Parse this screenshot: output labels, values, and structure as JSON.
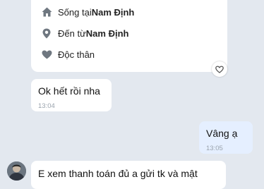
{
  "profile_card": {
    "rows": [
      {
        "icon": "home-icon",
        "prefix": "Sống tại ",
        "value": "Nam Định"
      },
      {
        "icon": "location-pin-icon",
        "prefix": "Đến từ ",
        "value": "Nam Định"
      },
      {
        "icon": "heart-icon",
        "prefix": "Độc thân",
        "value": ""
      }
    ]
  },
  "messages": [
    {
      "text": "Ok hết rồi nha",
      "time": "13:04",
      "sender": "other"
    },
    {
      "text": "Vâng ạ",
      "time": "13:05",
      "sender": "me"
    },
    {
      "text": "E xem thanh toán đủ a gửi tk và mật",
      "time": "",
      "sender": "other"
    }
  ],
  "colors": {
    "background": "#e3e8ef",
    "my_bubble": "#e5efff",
    "their_bubble": "#ffffff"
  }
}
